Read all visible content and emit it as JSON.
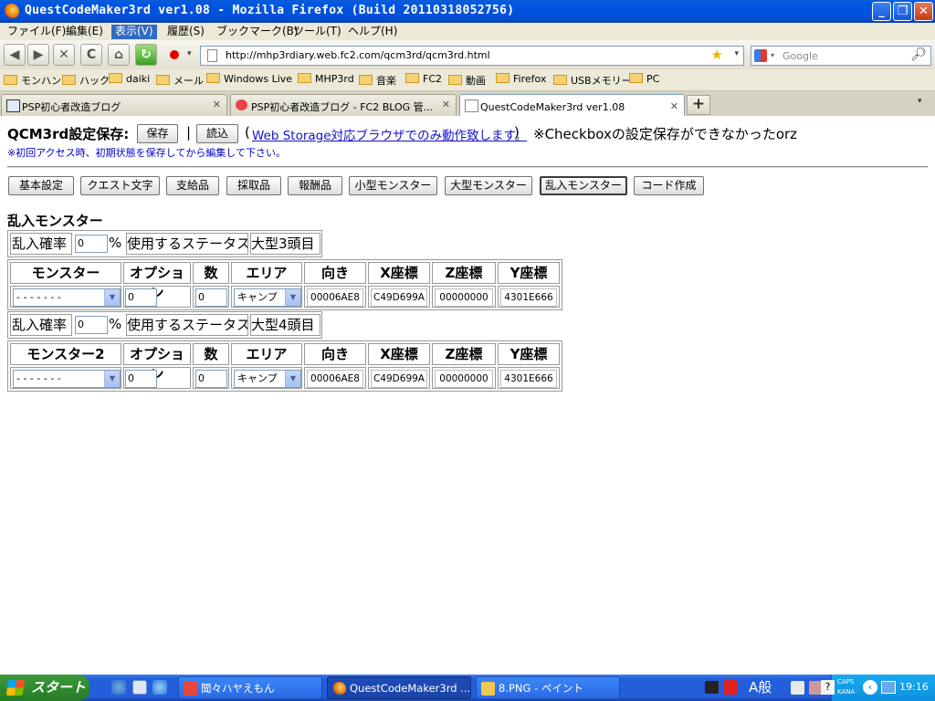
{
  "window": {
    "title": "QuestCodeMaker3rd ver1.08 - Mozilla Firefox (Build 20110318052756)",
    "minimize": "_",
    "restore": "❐",
    "close": "✕"
  },
  "menu": [
    "ファイル(F)",
    "編集(E)",
    "表示(V)",
    "履歴(S)",
    "ブックマーク(B)",
    "ツール(T)",
    "ヘルプ(H)"
  ],
  "menu_active_index": 2,
  "nav": {
    "back": "◀",
    "forward": "▶",
    "stop": "✕",
    "reload": "C",
    "home": "⌂",
    "url": "http://mhp3rdiary.web.fc2.com/qcm3rd/qcm3rd.html",
    "search_placeholder": "Google"
  },
  "bookmarks": [
    "モンハン",
    "ハック",
    "daiki",
    "メール",
    "Windows Live",
    "MHP3rd",
    "音楽",
    "FC2",
    "動画",
    "Firefox",
    "USBメモリー",
    "PC"
  ],
  "tabs": [
    {
      "label": "PSP初心者改造ブログ",
      "selected": false
    },
    {
      "label": "PSP初心者改造ブログ - FC2 BLOG 管...",
      "selected": false
    },
    {
      "label": "QuestCodeMaker3rd ver1.08",
      "selected": true
    }
  ],
  "newtab_label": "+",
  "page": {
    "save_label": "QCM3rd設定保存:",
    "save_button": "保存",
    "separator": "|",
    "load_button": "読込",
    "paren_open": "(",
    "web_storage_link": "Web Storage対応ブラウザでのみ動作致します。",
    "paren_close": ")",
    "checkbox_note": "※Checkboxの設定保存ができなかったorz",
    "init_note": "※初回アクセス時、初期状態を保存してから編集して下さい。",
    "menu_buttons": [
      "基本設定",
      "クエスト文字",
      "支給品",
      "採取品",
      "報酬品",
      "小型モンスター",
      "大型モンスター",
      "乱入モンスター",
      "コード作成"
    ],
    "active_menu_button": "乱入モンスター",
    "section_title": "乱入モンスター",
    "blocks": [
      {
        "rate_label": "乱入確率",
        "rate_value": "0",
        "percent": "%",
        "status_label": "使用するステータス",
        "status_target": "大型3頭目",
        "headers": [
          "モンスター",
          "オプション",
          "数",
          "エリア",
          "向き",
          "X座標",
          "Z座標",
          "Y座標"
        ],
        "row": {
          "monster": "- - - - - - -",
          "option": "0",
          "count": "0",
          "area": "キャンプ",
          "dir": "00006AE8",
          "x": "C49D699A",
          "z": "00000000",
          "y": "4301E666"
        }
      },
      {
        "rate_label": "乱入確率",
        "rate_value": "0",
        "percent": "%",
        "status_label": "使用するステータス",
        "status_target": "大型4頭目",
        "headers": [
          "モンスター2",
          "オプション",
          "数",
          "エリア",
          "向き",
          "X座標",
          "Z座標",
          "Y座標"
        ],
        "row": {
          "monster": "- - - - - - -",
          "option": "0",
          "count": "0",
          "area": "キャンプ",
          "dir": "00006AE8",
          "x": "C49D699A",
          "z": "00000000",
          "y": "4301E666"
        }
      }
    ]
  },
  "taskbar": {
    "start": "スタート",
    "tasks": [
      "聞々ハヤえもん",
      "QuestCodeMaker3rd ...",
      "8.PNG - ペイント"
    ],
    "ime": "A般",
    "caps": "CAPS",
    "kana": "KANA",
    "clock": "19:16"
  }
}
